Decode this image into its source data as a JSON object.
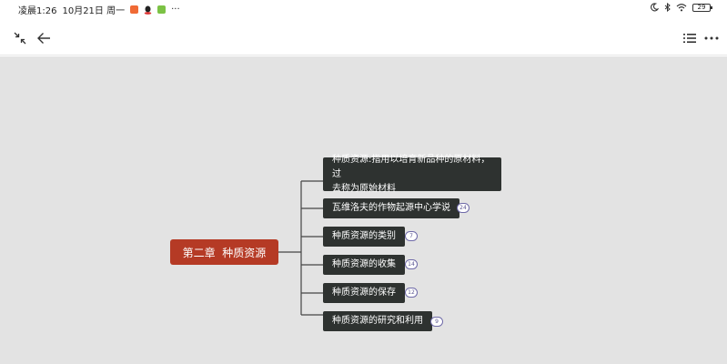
{
  "status_bar": {
    "time": "凌晨1:26",
    "date": "10月21日 周一",
    "more": "···",
    "battery": "29",
    "app_icons": [
      {
        "name": "orange-app-icon",
        "color": "#f06a35"
      },
      {
        "name": "qq-icon",
        "color": "#222222"
      },
      {
        "name": "green-app-icon",
        "color": "#7cc245"
      }
    ]
  },
  "toolbar": {
    "left_icons": [
      "collapse-icon",
      "back-arrow-icon"
    ],
    "right_icons": [
      "outline-list-icon",
      "more-icon"
    ]
  },
  "mindmap": {
    "root": {
      "label": "第二章  种质资源",
      "color": "#b53a25"
    },
    "node_color": "#2e3230",
    "canvas_color": "#e3e3e3",
    "children": [
      {
        "label_line1": "种质资源:指用以培育新品种的原材料，过",
        "label_line2": "去称为原始材料",
        "count": ""
      },
      {
        "label_line1": "瓦维洛夫的作物起源中心学说",
        "label_line2": "",
        "count": "24"
      },
      {
        "label_line1": "种质资源的类别",
        "label_line2": "",
        "count": "7"
      },
      {
        "label_line1": "种质资源的收集",
        "label_line2": "",
        "count": "14"
      },
      {
        "label_line1": "种质资源的保存",
        "label_line2": "",
        "count": "12"
      },
      {
        "label_line1": "种质资源的研究和利用",
        "label_line2": "",
        "count": "9"
      }
    ]
  }
}
